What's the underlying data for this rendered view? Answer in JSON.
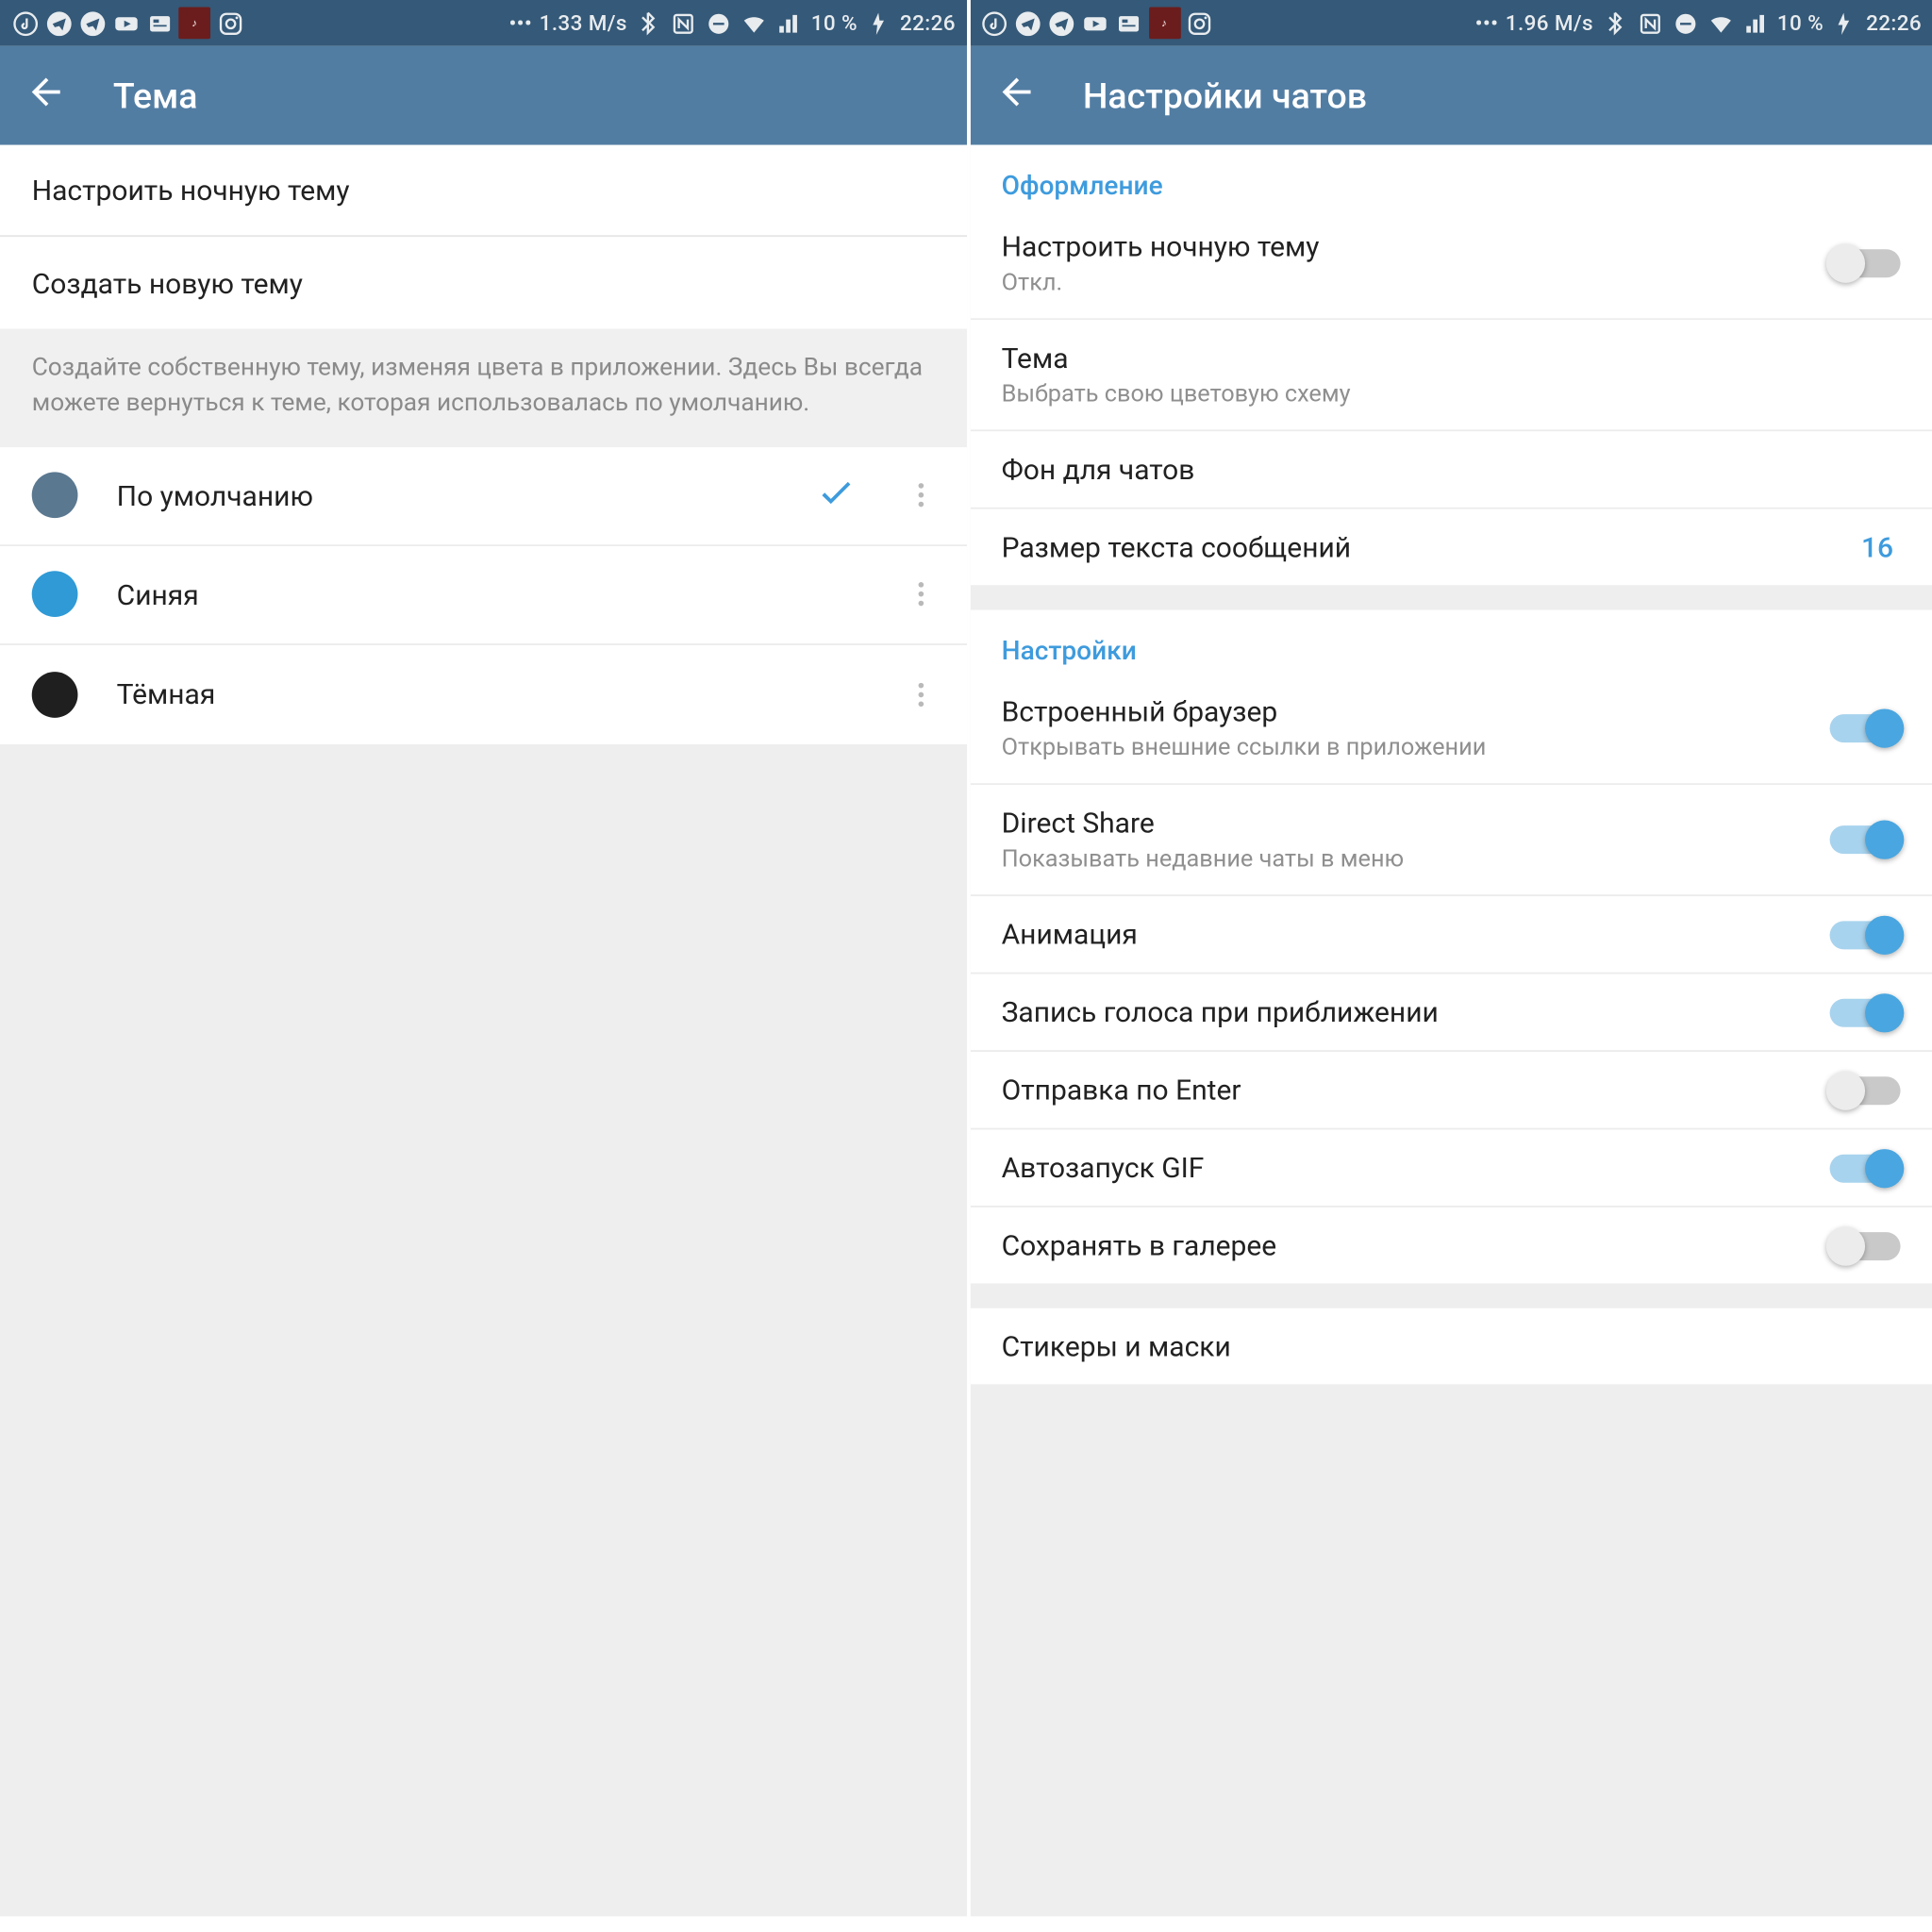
{
  "left": {
    "statusbar": {
      "speed": "1.33 M/s",
      "battery": "10 %",
      "time": "22:26"
    },
    "header": {
      "title": "Тема"
    },
    "items": {
      "configure_night": "Настроить ночную тему",
      "create_new": "Создать новую тему"
    },
    "hint": "Создайте собственную тему, изменяя цвета в приложении. Здесь Вы всегда можете вернуться к теме, которая использовалась по умолчанию.",
    "themes": [
      {
        "label": "По умолчанию",
        "color": "#5a7890",
        "selected": true
      },
      {
        "label": "Синяя",
        "color": "#2f9ad6",
        "selected": false
      },
      {
        "label": "Тёмная",
        "color": "#1f1f1f",
        "selected": false
      }
    ]
  },
  "right": {
    "statusbar": {
      "speed": "1.96 M/s",
      "battery": "10 %",
      "time": "22:26"
    },
    "header": {
      "title": "Настройки чатов"
    },
    "sections": {
      "appearance": {
        "title": "Оформление",
        "night_title": "Настроить ночную тему",
        "night_sub": "Откл.",
        "theme_title": "Тема",
        "theme_sub": "Выбрать свою цветовую схему",
        "bg": "Фон для чатов",
        "textsize_title": "Размер текста сообщений",
        "textsize_value": "16"
      },
      "settings": {
        "title": "Настройки",
        "browser_title": "Встроенный браузер",
        "browser_sub": "Открывать внешние ссылки в приложении",
        "directshare_title": "Direct Share",
        "directshare_sub": "Показывать недавние чаты в меню",
        "animation": "Анимация",
        "voice": "Запись голоса при приближении",
        "enter": "Отправка по Enter",
        "gif": "Автозапуск GIF",
        "gallery": "Сохранять в галерее"
      },
      "stickers": "Стикеры и маски"
    },
    "toggles": {
      "night": false,
      "browser": true,
      "directshare": true,
      "animation": true,
      "voice": true,
      "enter": false,
      "gif": true,
      "gallery": false
    }
  }
}
